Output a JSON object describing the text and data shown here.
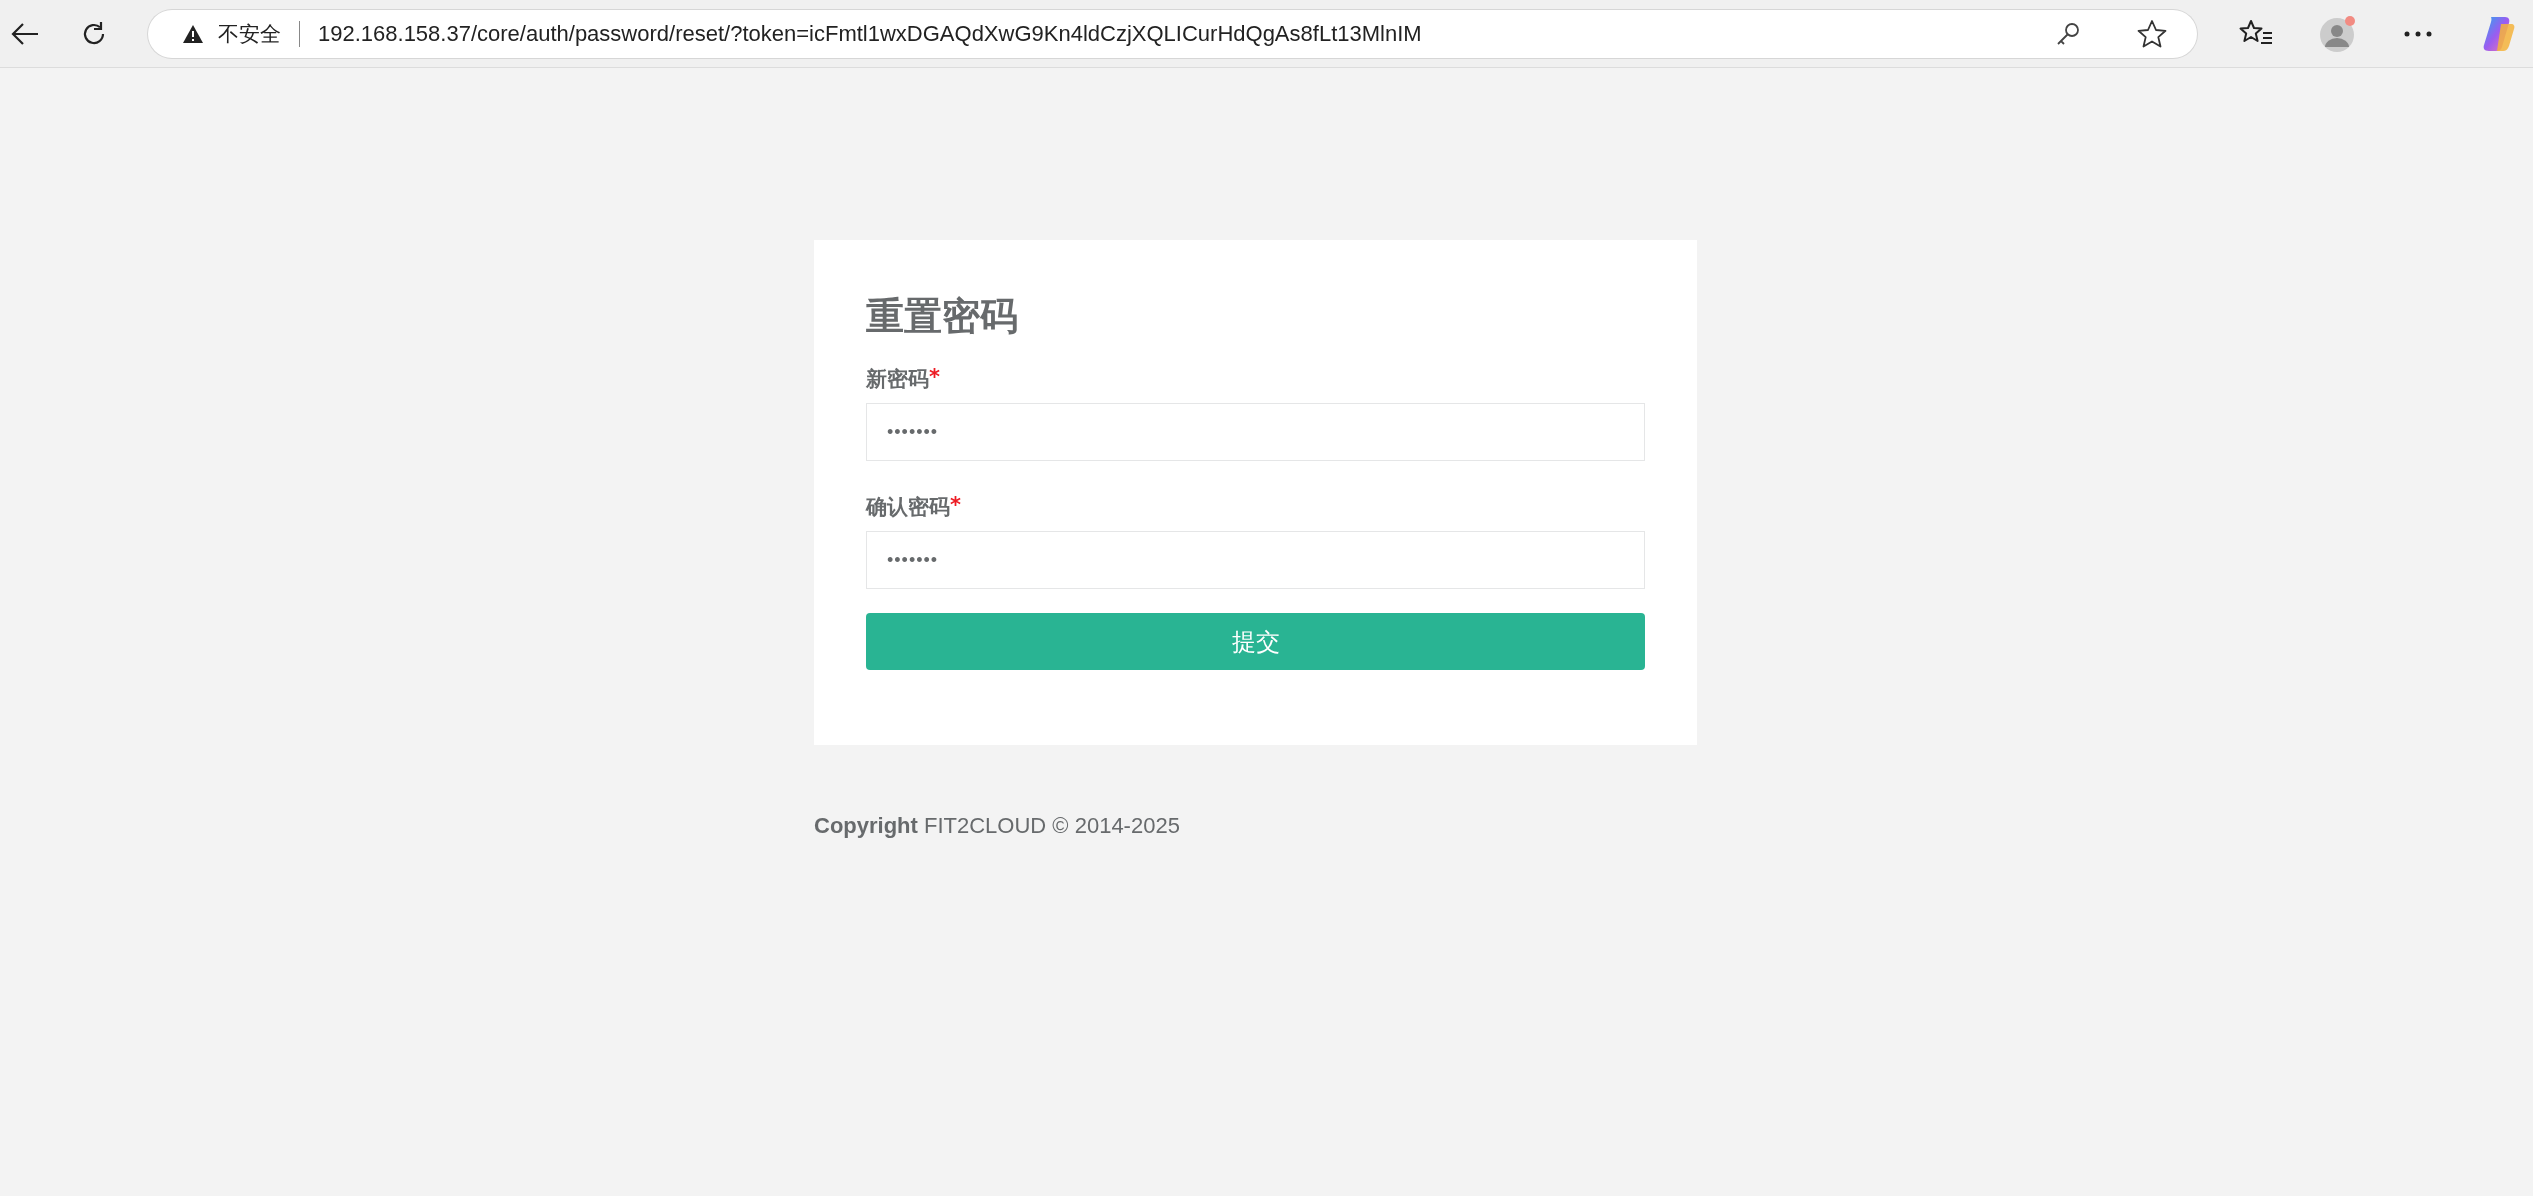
{
  "browser": {
    "security_label": "不安全",
    "url": "192.168.158.37/core/auth/password/reset/?token=icFmtl1wxDGAQdXwG9Kn4ldCzjXQLICurHdQgAs8fLt13MlnIM"
  },
  "form": {
    "title": "重置密码",
    "fields": [
      {
        "label": "新密码",
        "required_mark": "*",
        "value": "•••••••"
      },
      {
        "label": "确认密码",
        "required_mark": "*",
        "value": "•••••••"
      }
    ],
    "submit": "提交"
  },
  "footer": "**Copyright** FIT2CLOUD © 2014-2025"
}
